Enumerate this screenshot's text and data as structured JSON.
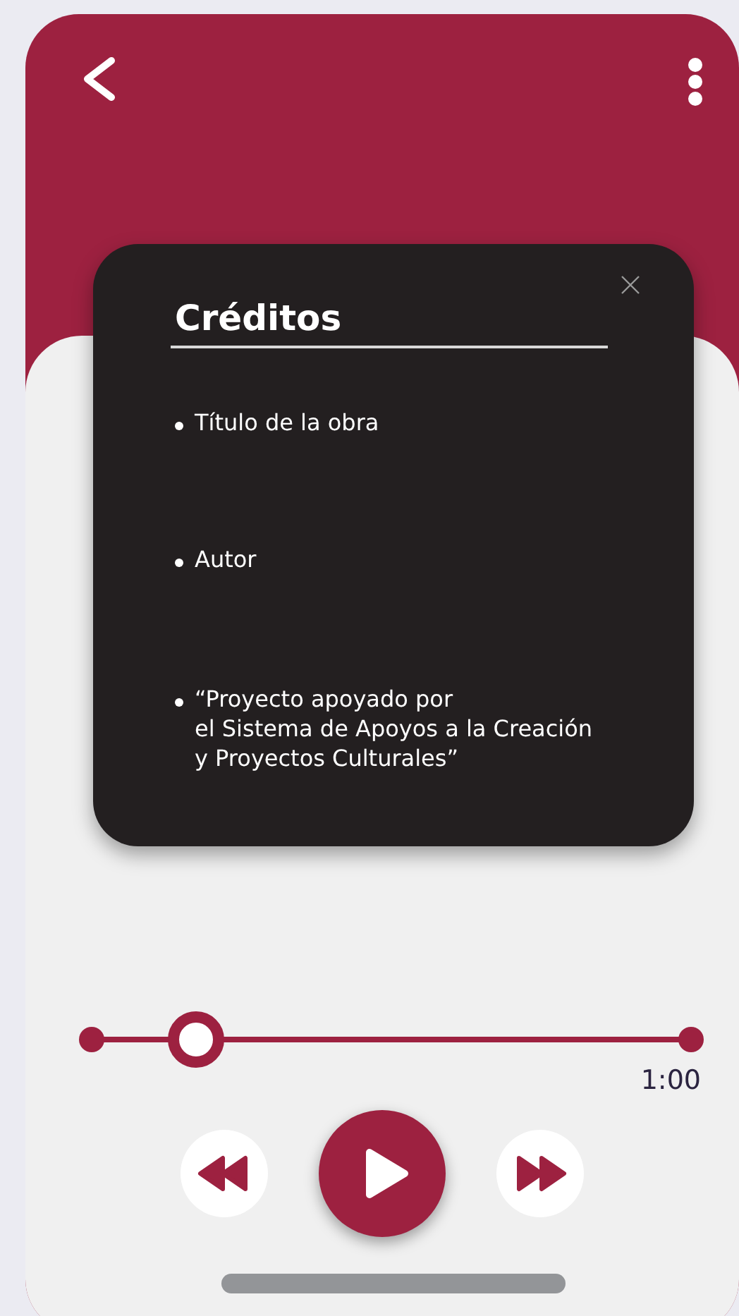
{
  "dialog": {
    "title": "Créditos",
    "items": [
      "Título de la obra",
      "Autor",
      "“Proyecto apoyado por\nel Sistema de Apoyos a la Creación\ny Proyectos Culturales”"
    ]
  },
  "player": {
    "level": 0.174,
    "time": "1:00",
    "playing": false
  }
}
